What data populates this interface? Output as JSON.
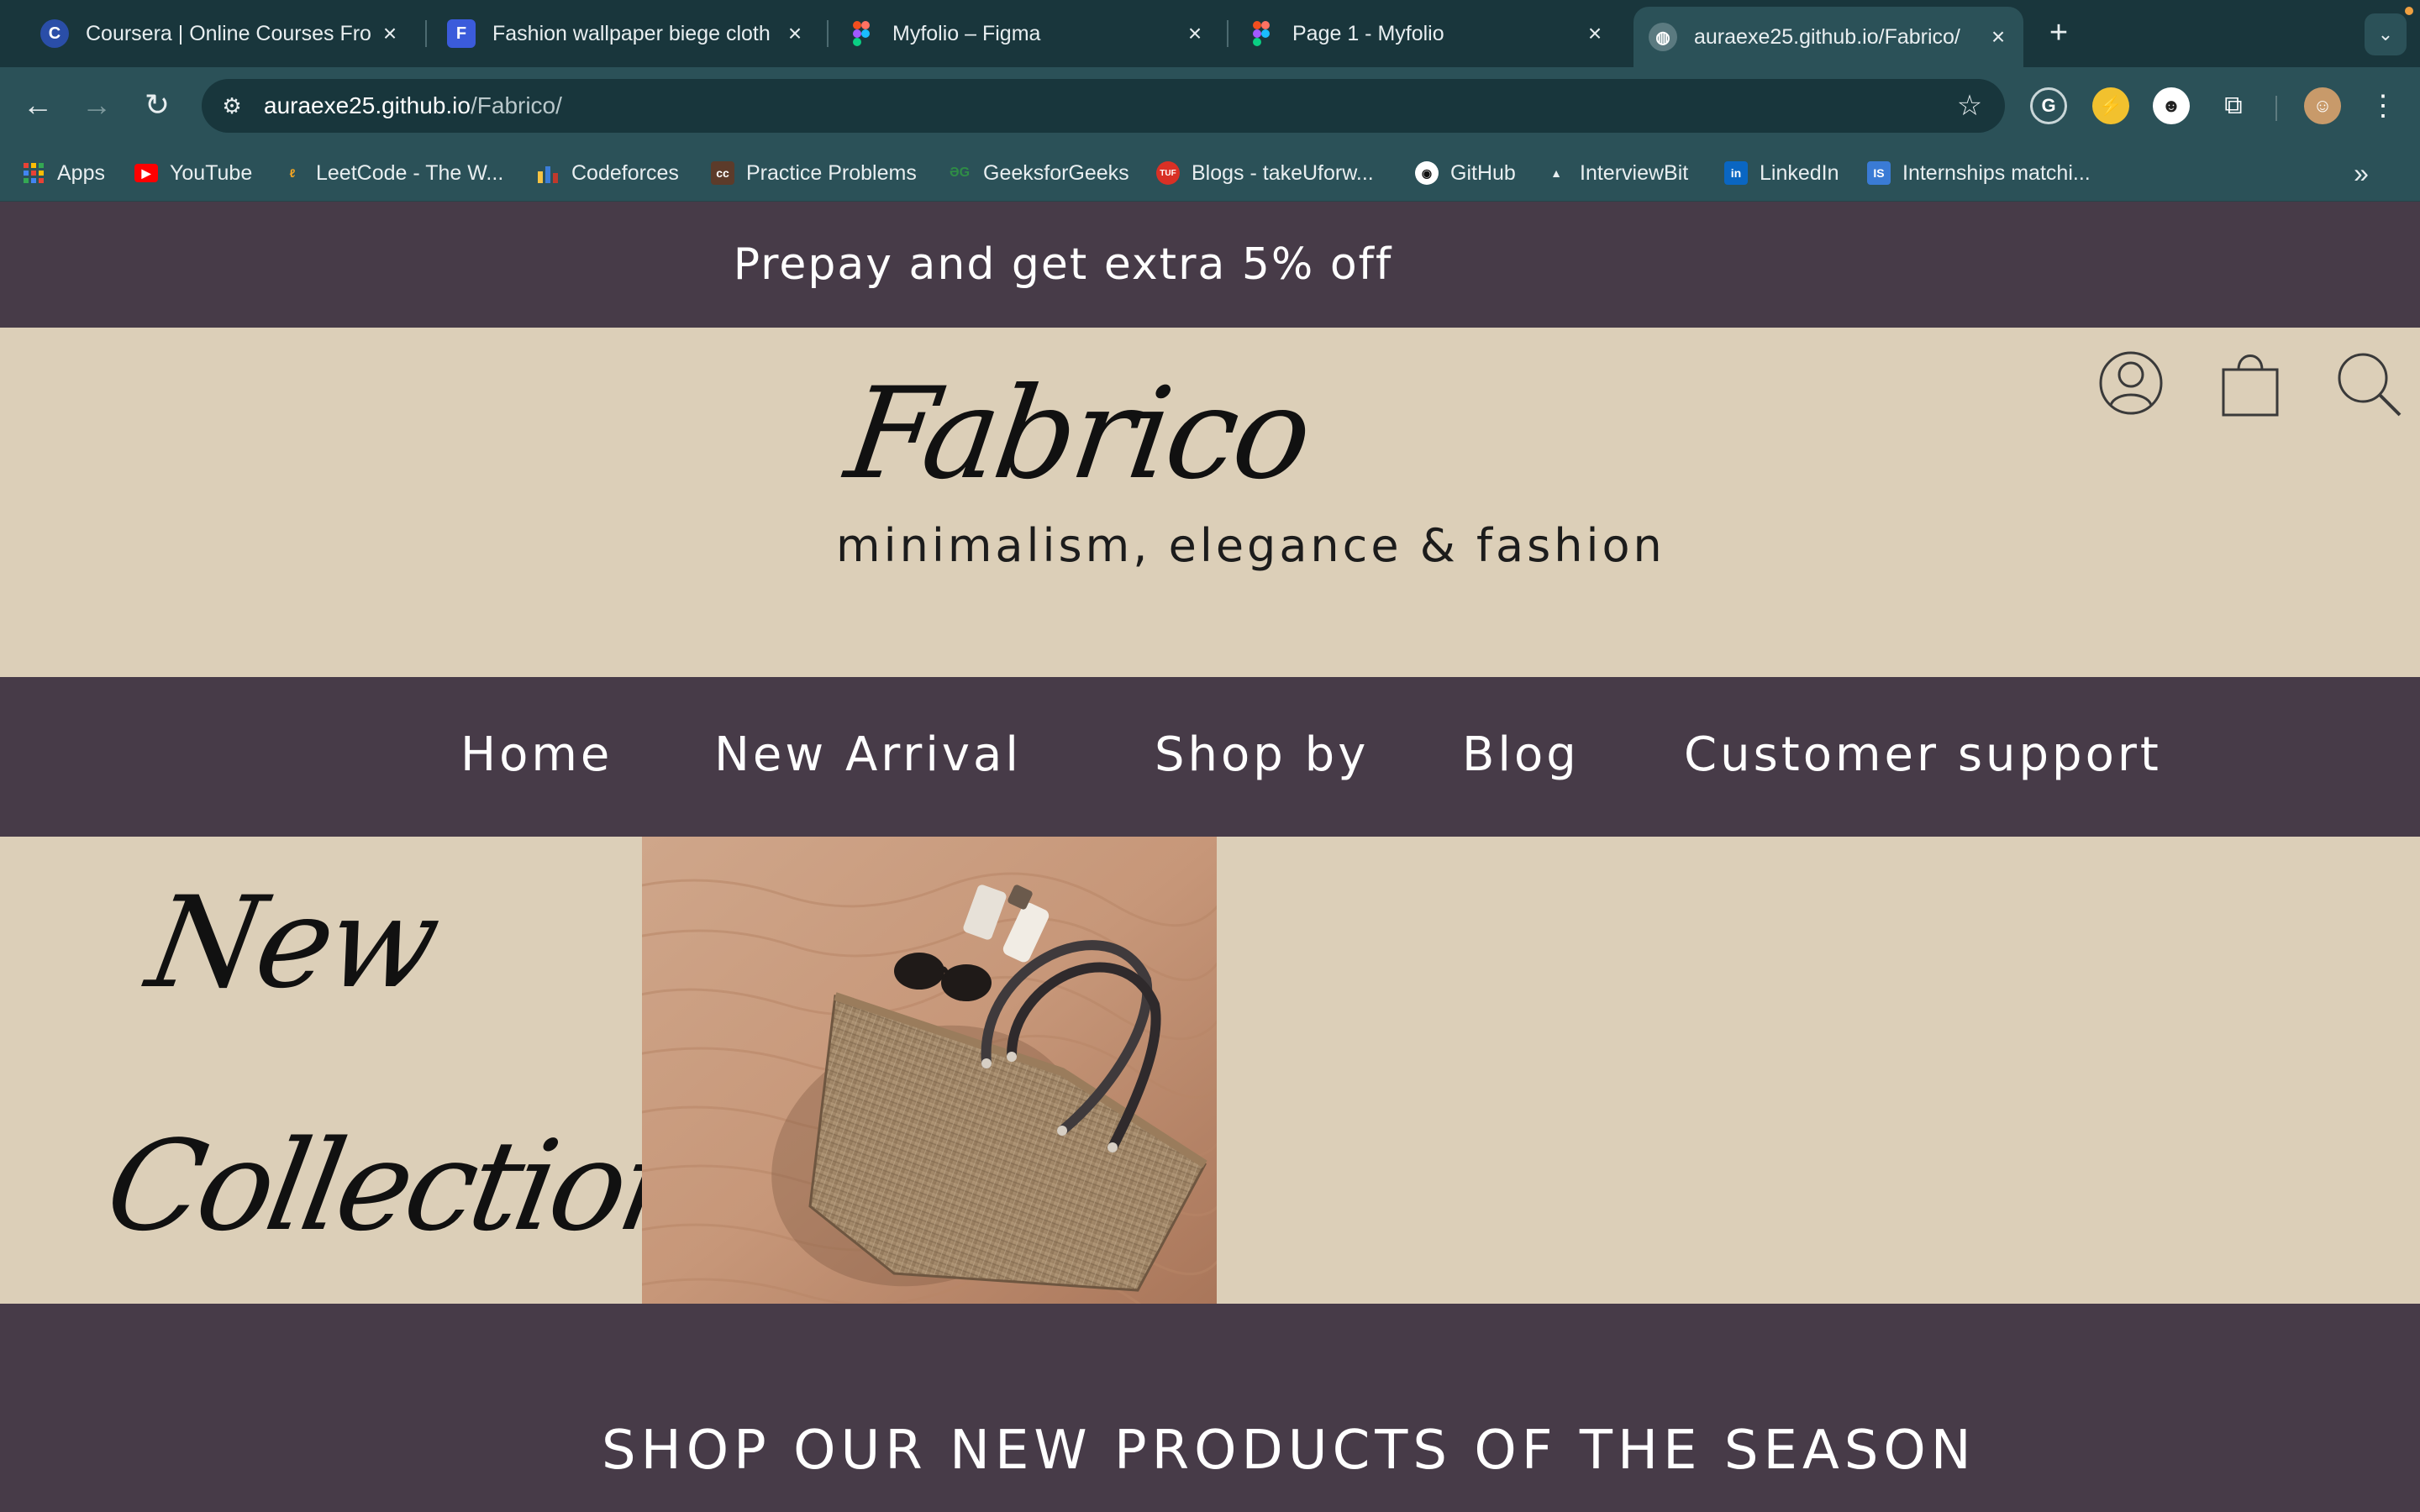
{
  "browser": {
    "tabs": [
      {
        "title": "Coursera | Online Courses Fro",
        "icon": "coursera-icon"
      },
      {
        "title": "Fashion wallpaper biege cloth",
        "icon": "document-icon"
      },
      {
        "title": "Myfolio – Figma",
        "icon": "figma-icon"
      },
      {
        "title": "Page 1 - Myfolio",
        "icon": "figma-icon"
      },
      {
        "title": "auraexe25.github.io/Fabrico/",
        "icon": "globe-icon",
        "active": true
      }
    ],
    "url_host": "auraexe25.github.io",
    "url_path": "/Fabrico/",
    "bookmarks": [
      {
        "label": "Apps"
      },
      {
        "label": "YouTube"
      },
      {
        "label": "LeetCode - The W..."
      },
      {
        "label": "Codeforces"
      },
      {
        "label": "Practice Problems"
      },
      {
        "label": "GeeksforGeeks"
      },
      {
        "label": "Blogs - takeUforw..."
      },
      {
        "label": "GitHub"
      },
      {
        "label": "InterviewBit"
      },
      {
        "label": "LinkedIn"
      },
      {
        "label": "Internships matchi..."
      }
    ],
    "colors": {
      "tabbar": "#19363c",
      "toolbar": "#2b5158"
    }
  },
  "site": {
    "promo": "Prepay and get extra 5% off",
    "logo": "Fabrico",
    "tagline": "minimalism, elegance & fashion",
    "nav": [
      {
        "label": "Home"
      },
      {
        "label": "New Arrival"
      },
      {
        "label": "Shop by"
      },
      {
        "label": "Blog"
      },
      {
        "label": "Customer support"
      }
    ],
    "hero": {
      "line1": "New",
      "line2": "Collection"
    },
    "section_title": "SHOP OUR NEW PRODUCTS OF THE SEASON",
    "colors": {
      "dark": "#473b48",
      "beige": "#dccfb8"
    }
  }
}
